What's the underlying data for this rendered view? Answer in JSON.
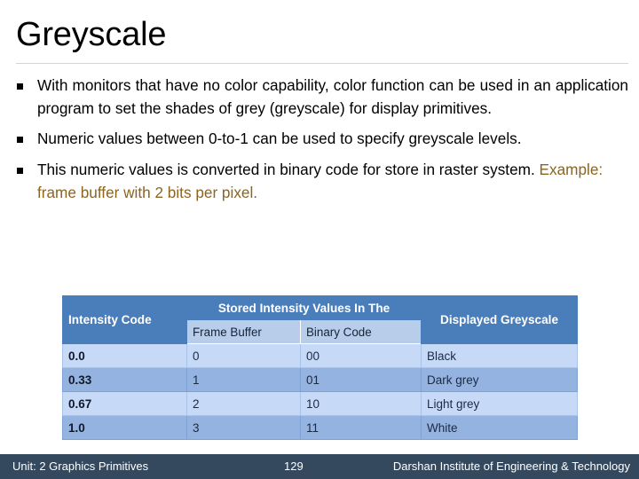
{
  "slide": {
    "title": "Greyscale"
  },
  "body": {
    "bullet_glyph": "square-bullet",
    "bullets": [
      {
        "text": "With monitors that have no color capability, color function can be used in an application program to set the shades of grey (greyscale) for display primitives."
      },
      {
        "text": "Numeric values between 0-to-1 can be used to specify greyscale levels."
      },
      {
        "text_plain": "This numeric values is converted in binary code for store in raster system. ",
        "text_highlight": "Example: frame buffer with 2 bits per pixel.",
        "highlight_color": "#8a6523"
      }
    ]
  },
  "table": {
    "header_main": {
      "intensity_code": "Intensity Code",
      "stored_intensity": "Stored Intensity Values In The",
      "displayed_greyscale": "Displayed Greyscale"
    },
    "header_sub": {
      "frame_buffer": "Frame Buffer",
      "binary_code": "Binary Code"
    },
    "rows": [
      {
        "intensity_code": "0.0",
        "frame_buffer": "0",
        "binary_code": "00",
        "greyscale": "Black"
      },
      {
        "intensity_code": "0.33",
        "frame_buffer": "1",
        "binary_code": "01",
        "greyscale": "Dark grey"
      },
      {
        "intensity_code": "0.67",
        "frame_buffer": "2",
        "binary_code": "10",
        "greyscale": "Light grey"
      },
      {
        "intensity_code": "1.0",
        "frame_buffer": "3",
        "binary_code": "11",
        "greyscale": "White"
      }
    ],
    "colors": {
      "header": "#4a7ebb",
      "subheader": "#b7cdea",
      "row_light": "#c6d9f7",
      "row_dark": "#95b3e0"
    }
  },
  "footer": {
    "unit": "Unit: 2 Graphics Primitives",
    "page": "129",
    "organization": "Darshan Institute of Engineering & Technology",
    "background": "#34495e"
  }
}
